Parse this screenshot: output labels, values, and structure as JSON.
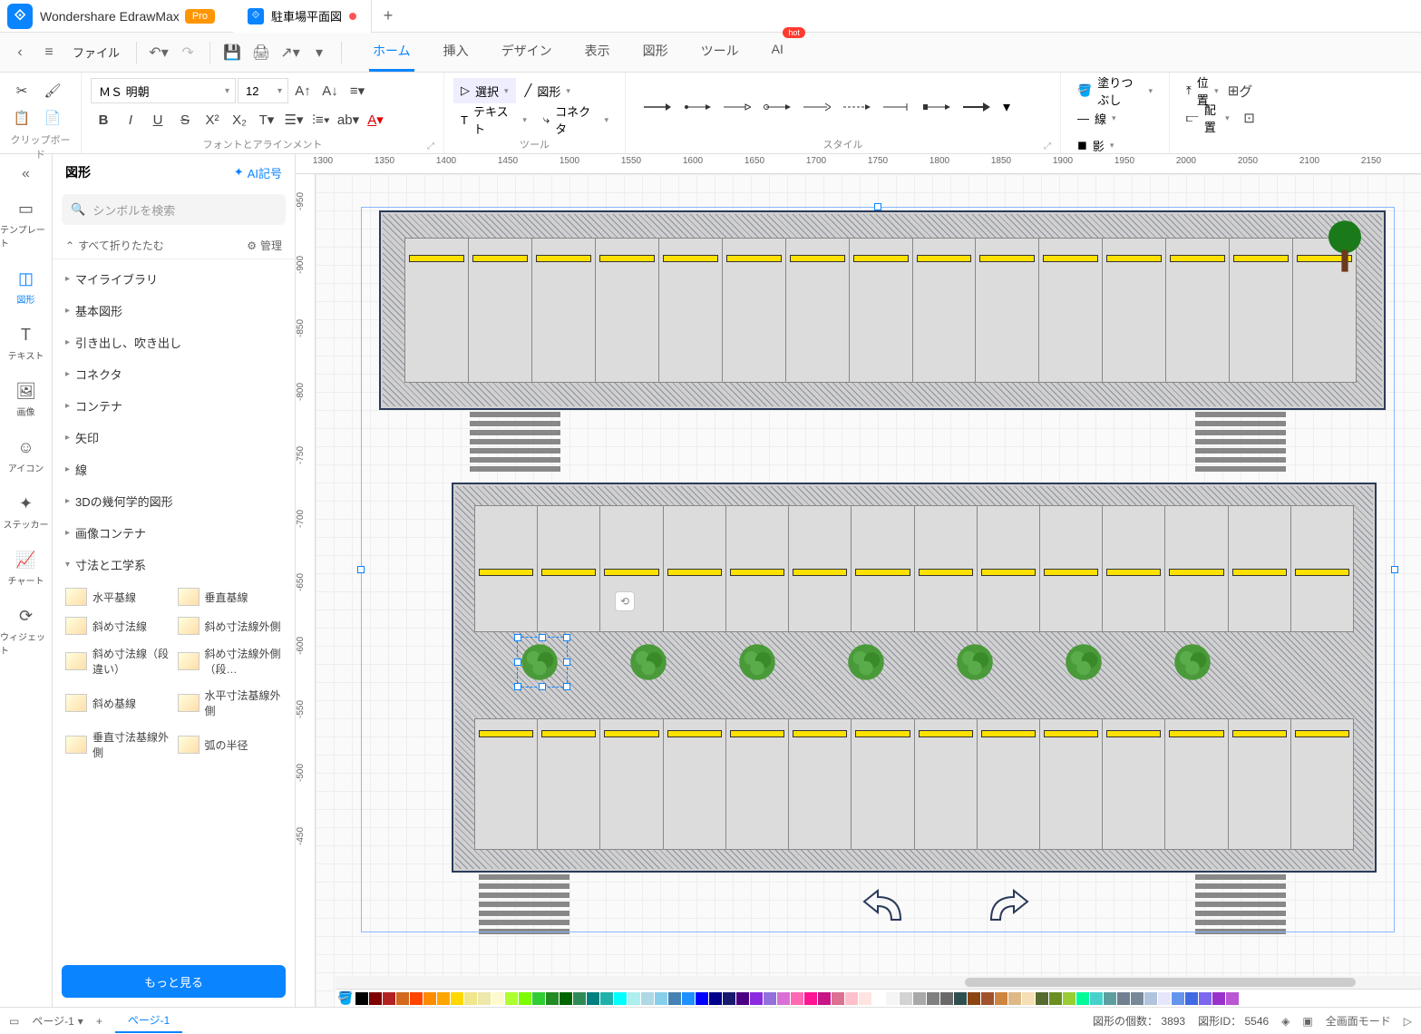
{
  "title": {
    "app": "Wondershare EdrawMax",
    "badge": "Pro",
    "doc": "駐車場平面図"
  },
  "menu": {
    "file": "ファイル",
    "tabs": [
      "ホーム",
      "挿入",
      "デザイン",
      "表示",
      "図形",
      "ツール",
      "AI"
    ],
    "active": 0,
    "hot": "hot"
  },
  "ribbon": {
    "clipboard": "クリップボード",
    "font_align": "フォントとアラインメント",
    "tool": "ツール",
    "style": "スタイル",
    "font": "ＭＳ 明朝",
    "size": "12",
    "select": "選択",
    "shape": "図形",
    "text": "テキスト",
    "connector": "コネクタ",
    "fill": "塗りつぶし",
    "line": "線",
    "shadow": "影",
    "position": "位置",
    "align2": "配置",
    "group": "グ"
  },
  "leftbar": {
    "items": [
      {
        "label": "テンプレート"
      },
      {
        "label": "図形"
      },
      {
        "label": "テキスト"
      },
      {
        "label": "画像"
      },
      {
        "label": "アイコン"
      },
      {
        "label": "ステッカー"
      },
      {
        "label": "チャート"
      },
      {
        "label": "ウィジェット"
      }
    ],
    "active": 1
  },
  "shapes": {
    "title": "図形",
    "ai": "AI記号",
    "search_ph": "シンボルを検索",
    "fold_all": "すべて折りたたむ",
    "manage": "管理",
    "cats": [
      "マイライブラリ",
      "基本図形",
      "引き出し、吹き出し",
      "コネクタ",
      "コンテナ",
      "矢印",
      "線",
      "3Dの幾何学的図形",
      "画像コンテナ",
      "寸法と工学系"
    ],
    "open_index": 9,
    "dim_items": [
      "水平基線",
      "垂直基線",
      "斜め寸法線",
      "斜め寸法線外側",
      "斜め寸法線（段違い）",
      "斜め寸法線外側（段…",
      "斜め基線",
      "水平寸法基線外側",
      "垂直寸法基線外側",
      "弧の半径"
    ],
    "more": "もっと見る"
  },
  "ruler_h": [
    1300,
    1350,
    1400,
    1450,
    1500,
    1550,
    1600,
    1650,
    1700,
    1750,
    1800,
    1850,
    1900,
    1950,
    2000,
    2050,
    2100,
    2150
  ],
  "ruler_v": [
    -950,
    -900,
    -850,
    -800,
    -750,
    -700,
    -650,
    -600,
    -550,
    -500,
    -450
  ],
  "status": {
    "page_sel": "ページ-1",
    "page_tab": "ページ-1",
    "count_label": "図形の個数：",
    "count": "3893",
    "id_label": "図形ID：",
    "id": "5546",
    "fullscreen": "全画面モード"
  },
  "colors": [
    "#000",
    "#7f0000",
    "#b22222",
    "#d2691e",
    "#ff4500",
    "#ff8c00",
    "#ffa500",
    "#ffd700",
    "#f0e68c",
    "#eee8aa",
    "#fffacd",
    "#adff2f",
    "#7cfc00",
    "#32cd32",
    "#228b22",
    "#006400",
    "#2e8b57",
    "#008080",
    "#20b2aa",
    "#00ffff",
    "#afeeee",
    "#add8e6",
    "#87ceeb",
    "#4682b4",
    "#1e90ff",
    "#0000ff",
    "#00008b",
    "#191970",
    "#4b0082",
    "#8a2be2",
    "#9370db",
    "#da70d6",
    "#ff69b4",
    "#ff1493",
    "#c71585",
    "#db7093",
    "#ffc0cb",
    "#ffe4e1",
    "#fff",
    "#f5f5f5",
    "#d3d3d3",
    "#a9a9a9",
    "#808080",
    "#696969",
    "#2f4f4f",
    "#8b4513",
    "#a0522d",
    "#cd853f",
    "#deb887",
    "#f5deb3",
    "#556b2f",
    "#6b8e23",
    "#9acd32",
    "#00fa9a",
    "#48d1cc",
    "#5f9ea0",
    "#708090",
    "#778899",
    "#b0c4de",
    "#e6e6fa",
    "#6495ed",
    "#4169e1",
    "#7b68ee",
    "#9932cc",
    "#ba55d3"
  ]
}
